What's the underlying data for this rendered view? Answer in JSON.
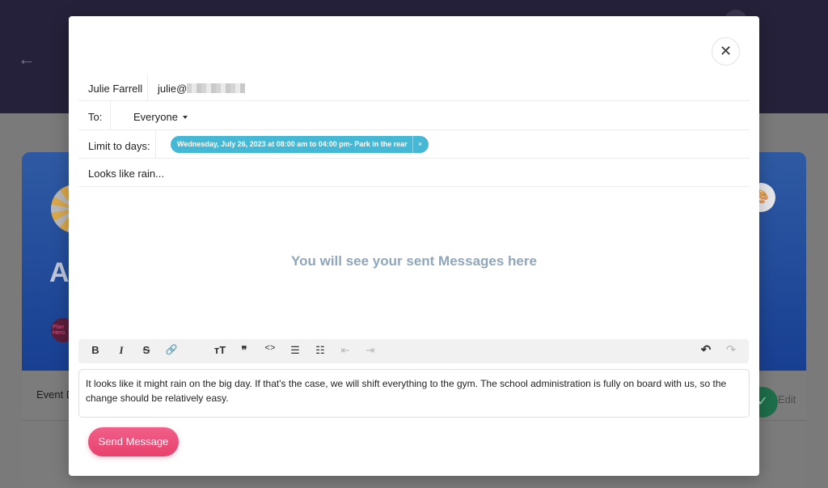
{
  "background": {
    "tab_label": "Event D",
    "edit_label": "Edit",
    "big_letter": "A",
    "small_logo_text": "Plan Hero"
  },
  "modal": {
    "close_symbol": "✕",
    "from": {
      "name": "Julie Farrell",
      "email_prefix": "julie@"
    },
    "to": {
      "label": "To:",
      "value": "Everyone"
    },
    "days": {
      "label": "Limit to days:",
      "chip": "Wednesday, July 26, 2023 at 08:00 am to 04:00 pm- Park in the rear",
      "chip_remove": "×"
    },
    "subject": "Looks like rain...",
    "empty_state": "You will see your sent Messages here",
    "toolbar": {
      "bold": "B",
      "italic": "I",
      "strike": "S",
      "link": "🔗",
      "heading": "тT",
      "quote": "❞",
      "code": "<>",
      "bullets": "☰",
      "numbers": "☷",
      "outdent": "⇤",
      "indent": "⇥",
      "undo": "↶",
      "redo": "↷"
    },
    "body": "It looks like it might rain on the big day. If that's the case, we will shift everything to the gym. The school administration is fully on board with us, so the change should be relatively easy.",
    "send_label": "Send Message"
  },
  "colors": {
    "accent": "#e8406c",
    "chip": "#45b8d6",
    "empty_text": "#8fa6bc",
    "header_bg": "#25213a"
  }
}
